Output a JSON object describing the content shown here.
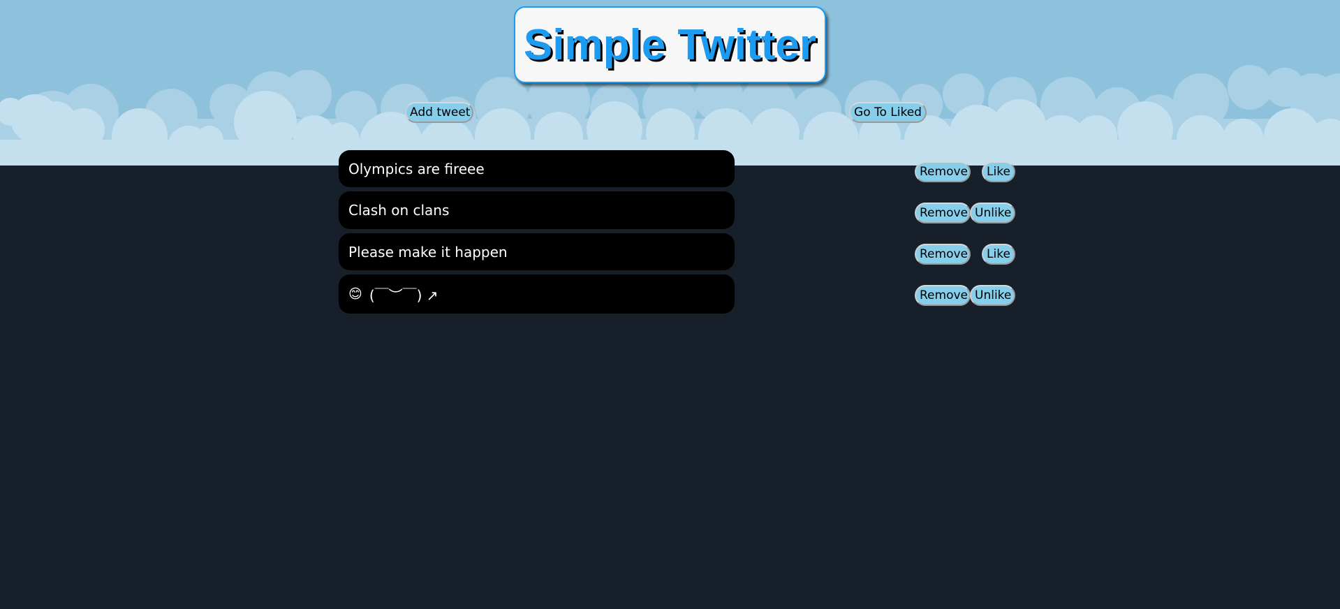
{
  "app": {
    "title": "Simple Twitter"
  },
  "toolbar": {
    "add_tweet_label": "Add tweet",
    "go_to_liked_label": "Go To Liked"
  },
  "tweets": [
    {
      "text": "Olympics are fireee",
      "remove_label": "Remove",
      "like_label": "Like",
      "liked": false
    },
    {
      "text": "Clash on clans",
      "remove_label": "Remove",
      "like_label": "Unlike",
      "liked": true
    },
    {
      "text": "Please make it happen",
      "remove_label": "Remove",
      "like_label": "Like",
      "liked": false
    },
    {
      "emoji": "😊",
      "text": "(￣︶￣) ↗",
      "remove_label": "Remove",
      "like_label": "Unlike",
      "liked": true
    }
  ],
  "colors": {
    "sky": "#8ec2dc",
    "cloud_back": "#a9d0e4",
    "cloud_front": "#c4e0ef",
    "page_background": "#17202a",
    "title_text": "#1d9bf0",
    "button": "#87ceeb",
    "tweet_background": "#000000"
  }
}
